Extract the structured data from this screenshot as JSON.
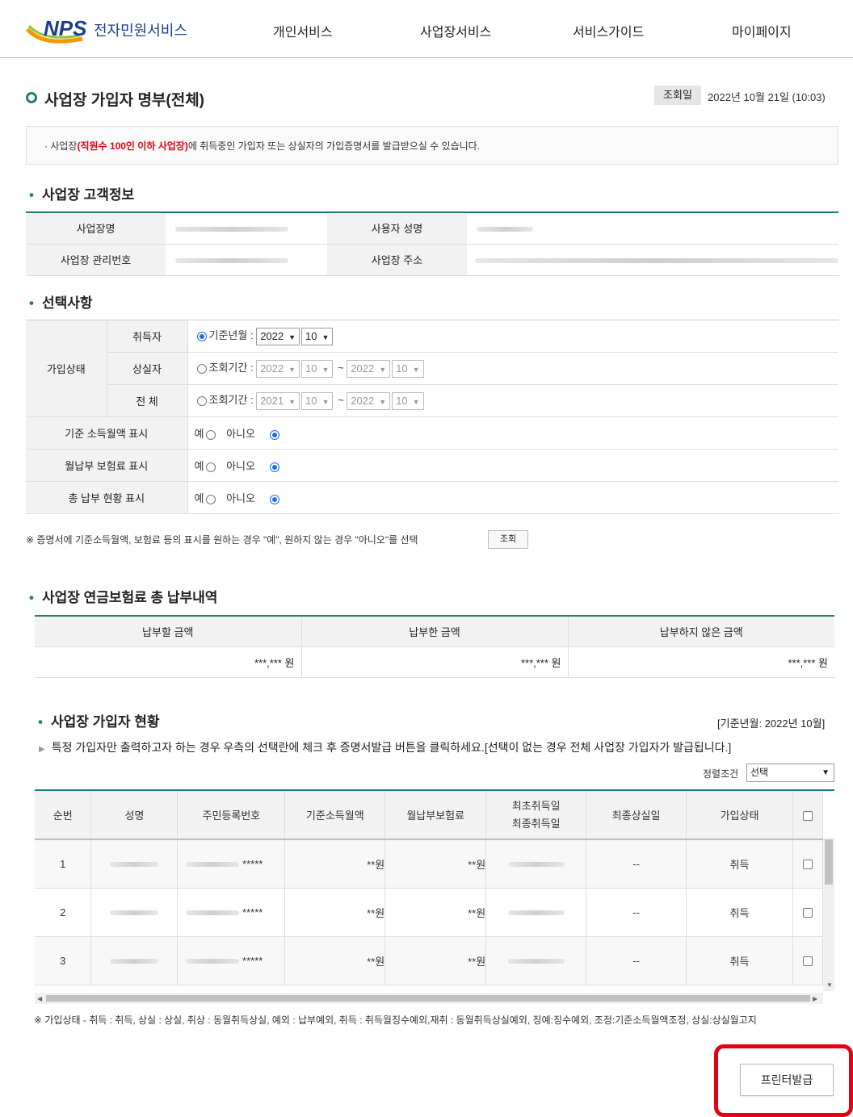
{
  "header": {
    "logo_mark": "NPS",
    "logo_text": "전자민원서비스",
    "nav": [
      "개인서비스",
      "사업장서비스",
      "서비스가이드",
      "마이페이지"
    ]
  },
  "page": {
    "title": "사업장 가입자 명부(전체)",
    "date_label": "조회일",
    "date_value": "2022년 10월 21일 (10:03)",
    "notice_pre": "·   사업장",
    "notice_red": "(직원수 100인 이하 사업장)",
    "notice_post": "에 취득중인 가입자 또는 상실자의 가입증명서를 발급받으실 수 있습니다."
  },
  "customer": {
    "section_title": "사업장 고객정보",
    "name_label": "사업장명",
    "user_label": "사용자 성명",
    "mgmt_label": "사업장 관리번호",
    "addr_label": "사업장 주소"
  },
  "options": {
    "section_title": "선택사항",
    "status_label": "가입상태",
    "acquired_label": "취득자",
    "lost_label": "상실자",
    "all_label": "전 체",
    "base_month_label": "기준년월 :",
    "period_label": "조회기간 :",
    "tilde": "~",
    "acquired": {
      "year": "2022",
      "month": "10"
    },
    "lost": {
      "from_year": "2022",
      "from_month": "10",
      "to_year": "2022",
      "to_month": "10"
    },
    "all": {
      "from_year": "2021",
      "from_month": "10",
      "to_year": "2022",
      "to_month": "10"
    },
    "rows": [
      {
        "label": "기준 소득월액 표시",
        "yes": "예",
        "no": "아니오"
      },
      {
        "label": "월납부 보험료 표시",
        "yes": "예",
        "no": "아니오"
      },
      {
        "label": "총 납부 현황 표시",
        "yes": "예",
        "no": "아니오"
      }
    ],
    "note": "※ 증명서에 기준소득월액, 보험료 등의 표시를 원하는 경우 \"예\", 원하지 않는 경우 \"아니오\"를 선택",
    "query_button": "조회"
  },
  "payment": {
    "section_title": "사업장 연금보험료 총 납부내역",
    "headers": [
      "납부할 금액",
      "납부한 금액",
      "납부하지 않은 금액"
    ],
    "values": [
      "***,*** 원",
      "***,*** 원",
      "***,*** 원"
    ]
  },
  "members": {
    "section_title": "사업장 가입자 현황",
    "base_note": "[기준년월: 2022년 10월]",
    "instruction": "특정 가입자만 출력하고자 하는 경우 우측의 선택란에 체크 후 증명서발급 버튼을 클릭하세요.[선택이 없는 경우 전체 사업장 가입자가 발급됩니다.]",
    "sort_label": "정렬조건",
    "sort_value": "선택",
    "headers": [
      "순번",
      "성명",
      "주민등록번호",
      "기준소득월액",
      "월납부보험료",
      "최초취득일",
      "최종취득일",
      "최종상실일",
      "가입상태"
    ],
    "rows": [
      {
        "no": "1",
        "rrn_mask": "*****",
        "income": "**원",
        "premium": "**원",
        "lost": "--",
        "status": "취득"
      },
      {
        "no": "2",
        "rrn_mask": "*****",
        "income": "**원",
        "premium": "**원",
        "lost": "--",
        "status": "취득"
      },
      {
        "no": "3",
        "rrn_mask": "*****",
        "income": "**원",
        "premium": "**원",
        "lost": "--",
        "status": "취득"
      }
    ]
  },
  "legend": "※ 가입상태 - 취득 : 취득, 상실 : 상실, 취상 : 동월취득상실, 예외 : 납부예외, 취득 : 취득월징수예외,재취 : 동월취득상실예외, 징예:징수예외, 조정:기준소득월액조정, 상실:상실월고지",
  "print_button": "프린터발급"
}
